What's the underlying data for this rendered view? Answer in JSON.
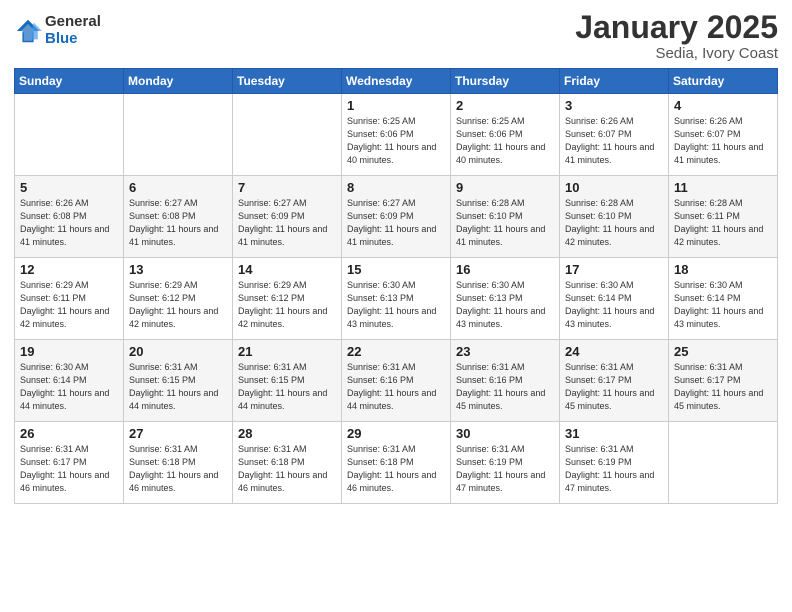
{
  "logo": {
    "general": "General",
    "blue": "Blue"
  },
  "header": {
    "month": "January 2025",
    "location": "Sedia, Ivory Coast"
  },
  "days_of_week": [
    "Sunday",
    "Monday",
    "Tuesday",
    "Wednesday",
    "Thursday",
    "Friday",
    "Saturday"
  ],
  "weeks": [
    [
      {
        "day": "",
        "sunrise": "",
        "sunset": "",
        "daylight": ""
      },
      {
        "day": "",
        "sunrise": "",
        "sunset": "",
        "daylight": ""
      },
      {
        "day": "",
        "sunrise": "",
        "sunset": "",
        "daylight": ""
      },
      {
        "day": "1",
        "sunrise": "Sunrise: 6:25 AM",
        "sunset": "Sunset: 6:06 PM",
        "daylight": "Daylight: 11 hours and 40 minutes."
      },
      {
        "day": "2",
        "sunrise": "Sunrise: 6:25 AM",
        "sunset": "Sunset: 6:06 PM",
        "daylight": "Daylight: 11 hours and 40 minutes."
      },
      {
        "day": "3",
        "sunrise": "Sunrise: 6:26 AM",
        "sunset": "Sunset: 6:07 PM",
        "daylight": "Daylight: 11 hours and 41 minutes."
      },
      {
        "day": "4",
        "sunrise": "Sunrise: 6:26 AM",
        "sunset": "Sunset: 6:07 PM",
        "daylight": "Daylight: 11 hours and 41 minutes."
      }
    ],
    [
      {
        "day": "5",
        "sunrise": "Sunrise: 6:26 AM",
        "sunset": "Sunset: 6:08 PM",
        "daylight": "Daylight: 11 hours and 41 minutes."
      },
      {
        "day": "6",
        "sunrise": "Sunrise: 6:27 AM",
        "sunset": "Sunset: 6:08 PM",
        "daylight": "Daylight: 11 hours and 41 minutes."
      },
      {
        "day": "7",
        "sunrise": "Sunrise: 6:27 AM",
        "sunset": "Sunset: 6:09 PM",
        "daylight": "Daylight: 11 hours and 41 minutes."
      },
      {
        "day": "8",
        "sunrise": "Sunrise: 6:27 AM",
        "sunset": "Sunset: 6:09 PM",
        "daylight": "Daylight: 11 hours and 41 minutes."
      },
      {
        "day": "9",
        "sunrise": "Sunrise: 6:28 AM",
        "sunset": "Sunset: 6:10 PM",
        "daylight": "Daylight: 11 hours and 41 minutes."
      },
      {
        "day": "10",
        "sunrise": "Sunrise: 6:28 AM",
        "sunset": "Sunset: 6:10 PM",
        "daylight": "Daylight: 11 hours and 42 minutes."
      },
      {
        "day": "11",
        "sunrise": "Sunrise: 6:28 AM",
        "sunset": "Sunset: 6:11 PM",
        "daylight": "Daylight: 11 hours and 42 minutes."
      }
    ],
    [
      {
        "day": "12",
        "sunrise": "Sunrise: 6:29 AM",
        "sunset": "Sunset: 6:11 PM",
        "daylight": "Daylight: 11 hours and 42 minutes."
      },
      {
        "day": "13",
        "sunrise": "Sunrise: 6:29 AM",
        "sunset": "Sunset: 6:12 PM",
        "daylight": "Daylight: 11 hours and 42 minutes."
      },
      {
        "day": "14",
        "sunrise": "Sunrise: 6:29 AM",
        "sunset": "Sunset: 6:12 PM",
        "daylight": "Daylight: 11 hours and 42 minutes."
      },
      {
        "day": "15",
        "sunrise": "Sunrise: 6:30 AM",
        "sunset": "Sunset: 6:13 PM",
        "daylight": "Daylight: 11 hours and 43 minutes."
      },
      {
        "day": "16",
        "sunrise": "Sunrise: 6:30 AM",
        "sunset": "Sunset: 6:13 PM",
        "daylight": "Daylight: 11 hours and 43 minutes."
      },
      {
        "day": "17",
        "sunrise": "Sunrise: 6:30 AM",
        "sunset": "Sunset: 6:14 PM",
        "daylight": "Daylight: 11 hours and 43 minutes."
      },
      {
        "day": "18",
        "sunrise": "Sunrise: 6:30 AM",
        "sunset": "Sunset: 6:14 PM",
        "daylight": "Daylight: 11 hours and 43 minutes."
      }
    ],
    [
      {
        "day": "19",
        "sunrise": "Sunrise: 6:30 AM",
        "sunset": "Sunset: 6:14 PM",
        "daylight": "Daylight: 11 hours and 44 minutes."
      },
      {
        "day": "20",
        "sunrise": "Sunrise: 6:31 AM",
        "sunset": "Sunset: 6:15 PM",
        "daylight": "Daylight: 11 hours and 44 minutes."
      },
      {
        "day": "21",
        "sunrise": "Sunrise: 6:31 AM",
        "sunset": "Sunset: 6:15 PM",
        "daylight": "Daylight: 11 hours and 44 minutes."
      },
      {
        "day": "22",
        "sunrise": "Sunrise: 6:31 AM",
        "sunset": "Sunset: 6:16 PM",
        "daylight": "Daylight: 11 hours and 44 minutes."
      },
      {
        "day": "23",
        "sunrise": "Sunrise: 6:31 AM",
        "sunset": "Sunset: 6:16 PM",
        "daylight": "Daylight: 11 hours and 45 minutes."
      },
      {
        "day": "24",
        "sunrise": "Sunrise: 6:31 AM",
        "sunset": "Sunset: 6:17 PM",
        "daylight": "Daylight: 11 hours and 45 minutes."
      },
      {
        "day": "25",
        "sunrise": "Sunrise: 6:31 AM",
        "sunset": "Sunset: 6:17 PM",
        "daylight": "Daylight: 11 hours and 45 minutes."
      }
    ],
    [
      {
        "day": "26",
        "sunrise": "Sunrise: 6:31 AM",
        "sunset": "Sunset: 6:17 PM",
        "daylight": "Daylight: 11 hours and 46 minutes."
      },
      {
        "day": "27",
        "sunrise": "Sunrise: 6:31 AM",
        "sunset": "Sunset: 6:18 PM",
        "daylight": "Daylight: 11 hours and 46 minutes."
      },
      {
        "day": "28",
        "sunrise": "Sunrise: 6:31 AM",
        "sunset": "Sunset: 6:18 PM",
        "daylight": "Daylight: 11 hours and 46 minutes."
      },
      {
        "day": "29",
        "sunrise": "Sunrise: 6:31 AM",
        "sunset": "Sunset: 6:18 PM",
        "daylight": "Daylight: 11 hours and 46 minutes."
      },
      {
        "day": "30",
        "sunrise": "Sunrise: 6:31 AM",
        "sunset": "Sunset: 6:19 PM",
        "daylight": "Daylight: 11 hours and 47 minutes."
      },
      {
        "day": "31",
        "sunrise": "Sunrise: 6:31 AM",
        "sunset": "Sunset: 6:19 PM",
        "daylight": "Daylight: 11 hours and 47 minutes."
      },
      {
        "day": "",
        "sunrise": "",
        "sunset": "",
        "daylight": ""
      }
    ]
  ]
}
